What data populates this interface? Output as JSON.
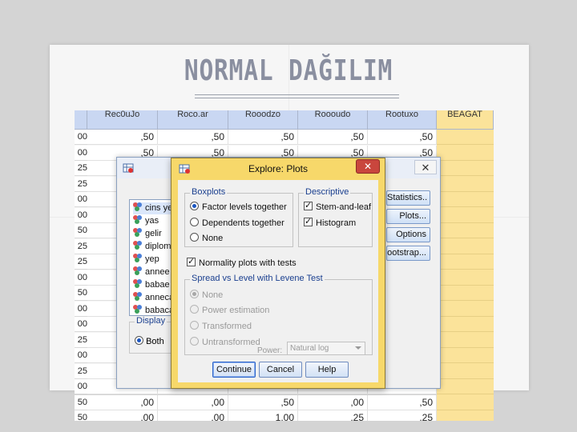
{
  "slide": {
    "title": "NORMAL DAĞILIM"
  },
  "spreadsheet": {
    "headers": [
      "Rec0uJo",
      "Roco.ar",
      "Rooodzo",
      "Roooudo",
      "Rootuxo",
      "BEAGAT"
    ],
    "row_heads": [
      "00",
      "00",
      "25",
      "25",
      "00",
      "00",
      "50",
      "25",
      "25",
      "00",
      "50",
      "00",
      "00",
      "25",
      "00",
      "25",
      "00",
      "50",
      "50"
    ],
    "rows": [
      [
        ",50",
        ",50",
        ",50",
        ",50",
        ",50"
      ],
      [
        ",50",
        ",50",
        ",50",
        ",50",
        ",50"
      ],
      [
        "",
        "",
        "",
        "",
        ""
      ],
      [
        "",
        "",
        "",
        "",
        ""
      ],
      [
        "",
        "",
        "",
        "",
        ""
      ],
      [
        "",
        "",
        "",
        "",
        ""
      ],
      [
        "",
        "",
        "",
        "",
        ""
      ],
      [
        "",
        "",
        "",
        "",
        ""
      ],
      [
        "",
        "",
        "",
        "",
        ""
      ],
      [
        "",
        "",
        "",
        "",
        ""
      ],
      [
        "",
        "",
        "",
        "",
        ""
      ],
      [
        "",
        "",
        "",
        "",
        ""
      ],
      [
        "",
        "",
        "",
        "",
        ""
      ],
      [
        "",
        "",
        "",
        "",
        ""
      ],
      [
        "",
        "",
        "",
        "",
        ""
      ],
      [
        "",
        "",
        "",
        "",
        ""
      ],
      [
        "",
        "",
        "",
        "",
        ""
      ],
      [
        ",00",
        ",00",
        ",50",
        ",00",
        ",50"
      ],
      [
        ",00",
        ",00",
        "1,00",
        ",25",
        ",25"
      ]
    ]
  },
  "explore_dialog": {
    "close_label": "✕",
    "variables": [
      "cins ye",
      "yas",
      "gelir",
      "diplom",
      "yep",
      "annee",
      "babae",
      "anneca",
      "babaca"
    ],
    "display_legend": "Display",
    "display_both": "Both",
    "buttons": [
      "Statistics..",
      "Plots...",
      "Options",
      "ootstrap..."
    ]
  },
  "plots_dialog": {
    "title": "Explore: Plots",
    "close_label": "✕",
    "boxplots": {
      "legend": "Boxplots",
      "options": [
        "Factor levels together",
        "Dependents together",
        "None"
      ],
      "selected": 0
    },
    "descriptive": {
      "legend": "Descriptive",
      "options": [
        "Stem-and-leaf",
        "Histogram"
      ],
      "checked": [
        true,
        true
      ]
    },
    "normality": {
      "label": "Normality plots with tests",
      "checked": true
    },
    "spread": {
      "legend": "Spread vs Level with Levene Test",
      "options": [
        "None",
        "Power estimation",
        "Transformed",
        "Untransformed"
      ],
      "selected": 0,
      "power_label": "Power:",
      "power_value": "Natural log"
    },
    "buttons": {
      "continue": "Continue",
      "cancel": "Cancel",
      "help": "Help"
    }
  }
}
